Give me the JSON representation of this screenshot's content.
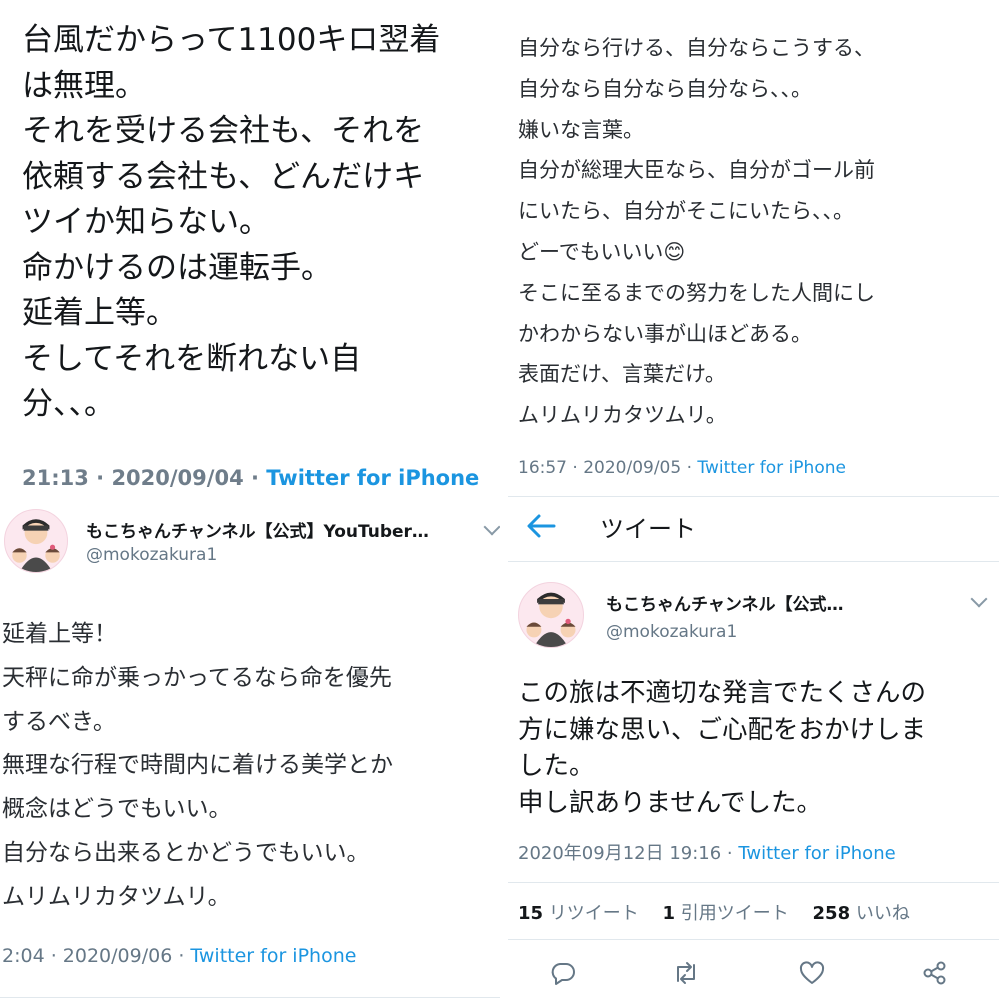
{
  "panels": {
    "top_left": {
      "text": "台風だからって1100キロ翌着\nは無理。\nそれを受ける会社も、それを\n依頼する会社も、どんだけキ\nツイか知らない。\n命かけるのは運転手。\n延着上等。\nそしてそれを断れない自\n分、、。",
      "time": "21:13 · 2020/09/04 · ",
      "source": "Twitter for iPhone"
    },
    "top_right": {
      "text": "自分なら行ける、自分ならこうする、\n自分なら自分なら自分なら、、。\n嫌いな言葉。\n自分が総理大臣なら、自分がゴール前\nにいたら、自分がそこにいたら、、。\nどーでもいいい😊\nそこに至るまでの努力をした人間にし\nかわからない事が山ほどある。\n表面だけ、言葉だけ。\nムリムリカタツムリ。",
      "time": "16:57 · 2020/09/05 · ",
      "source": "Twitter for iPhone"
    },
    "bottom_left": {
      "user_name": "もこちゃんチャンネル【公式】YouTuber…",
      "handle": "@mokozakura1",
      "text": "延着上等！\n天秤に命が乗っかってるなら命を優先\nするべき。\n無理な行程で時間内に着ける美学とか\n概念はどうでもいい。\n自分なら出来るとかどうでもいい。\nムリムリカタツムリ。",
      "time": "2:04 · 2020/09/06 · ",
      "source": "Twitter for iPhone"
    },
    "bottom_right": {
      "nav_title": "ツイート",
      "user_name": "もこちゃんチャンネル【公式…",
      "handle": "@mokozakura1",
      "text": "この旅は不適切な発言でたくさんの\n方に嫌な思い、ご心配をおかけしま\nした。\n申し訳ありませんでした。",
      "time": "2020年09月12日 19:16 · ",
      "source": "Twitter for iPhone",
      "stats": {
        "retweets_count": "15",
        "retweets_label": " リツイート",
        "quotes_count": "1",
        "quotes_label": " 引用ツイート",
        "likes_count": "258",
        "likes_label": " いいね"
      }
    }
  },
  "icons": {
    "back": "arrow-left-icon",
    "reply": "reply-icon",
    "retweet": "retweet-icon",
    "like": "heart-icon",
    "share": "share-icon",
    "dropdown": "chevron-down-icon"
  },
  "colors": {
    "link": "#1b95e0",
    "text": "#14171a",
    "muted": "#657786",
    "divider": "#e1e8ed"
  }
}
